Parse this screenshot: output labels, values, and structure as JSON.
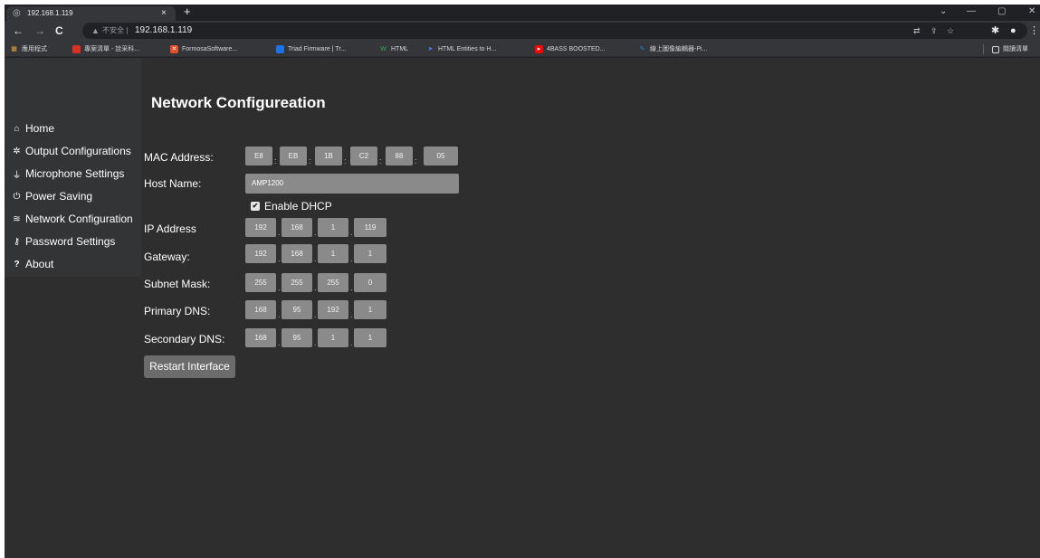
{
  "browser": {
    "tab": {
      "title": "192.168.1.119",
      "close": "×"
    },
    "new_tab": "+",
    "window_controls": {
      "minimize": "—",
      "maximize": "▢",
      "close": "✕",
      "tab_search": "⌄"
    },
    "nav": {
      "back": "←",
      "forward": "→",
      "reload": "C"
    },
    "address": {
      "security_icon": "▲",
      "security_text": "不安全 |",
      "url": "192.168.1.119"
    },
    "bookmarks": [
      {
        "label": "應用程式",
        "icon": "apps-grid-icon",
        "color": "#e8a33d"
      },
      {
        "label": "專案清單 - 詮采科...",
        "icon": "bookmark-red-icon",
        "color": "#d93025"
      },
      {
        "label": "FormosaSoftware...",
        "icon": "formosa-logo-icon",
        "color": "#e34c26"
      },
      {
        "label": "Triad Firmware | Tr...",
        "icon": "trello-icon",
        "color": "#1a73e8"
      },
      {
        "label": "HTML",
        "icon": "w-logo-icon",
        "color": "#34a853"
      },
      {
        "label": "HTML Entities to H...",
        "icon": "arrow-logo-icon",
        "color": "#4285f4"
      },
      {
        "label": "4BASS BOOSTED...",
        "icon": "youtube-icon",
        "color": "#ff0000"
      },
      {
        "label": "線上圖像編輯器-Pi...",
        "icon": "pixlr-icon",
        "color": "#1e88e5"
      }
    ],
    "reading_list": "閱讀清單"
  },
  "sidebar": {
    "items": [
      {
        "label": "Home",
        "icon": "home-icon",
        "glyph": "⌂"
      },
      {
        "label": "Output Configurations",
        "icon": "gear-icon",
        "glyph": "✲"
      },
      {
        "label": "Microphone Settings",
        "icon": "microphone-icon",
        "glyph": "⏚"
      },
      {
        "label": "Power Saving",
        "icon": "power-icon",
        "glyph": "⏻"
      },
      {
        "label": "Network Configuration",
        "icon": "wifi-icon",
        "glyph": "≋"
      },
      {
        "label": "Password Settings",
        "icon": "key-icon",
        "glyph": "⚷"
      },
      {
        "label": "About",
        "icon": "question-icon",
        "glyph": "?"
      }
    ]
  },
  "main": {
    "title": "Network Configureation",
    "mac": {
      "label": "MAC Address:",
      "octets": [
        "E8",
        "EB",
        "1B",
        "C2",
        "88",
        "05"
      ]
    },
    "host": {
      "label": "Host Name:",
      "value": "AMP1200"
    },
    "dhcp": {
      "label": "Enable DHCP",
      "checked": true,
      "check": "✔"
    },
    "ip": {
      "label": "IP Address",
      "octets": [
        "192",
        "168",
        "1",
        "119"
      ]
    },
    "gateway": {
      "label": "Gateway:",
      "octets": [
        "192",
        "168",
        "1",
        "1"
      ]
    },
    "subnet": {
      "label": "Subnet Mask:",
      "octets": [
        "255",
        "255",
        "255",
        "0"
      ]
    },
    "primary_dns": {
      "label": "Primary DNS:",
      "octets": [
        "168",
        "95",
        "192",
        "1"
      ]
    },
    "secondary_dns": {
      "label": "Secondary DNS:",
      "octets": [
        "168",
        "95",
        "1",
        "1"
      ]
    },
    "restart_label": "Restart Interface"
  }
}
